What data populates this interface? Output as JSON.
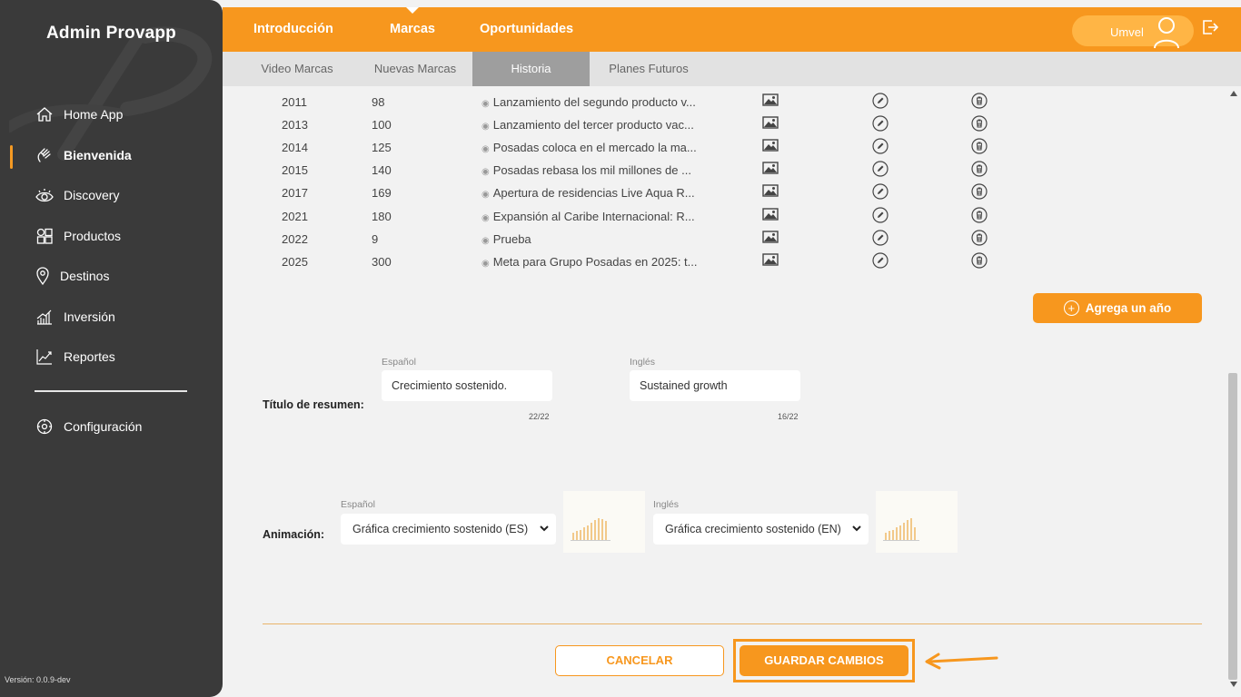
{
  "sidebar": {
    "title": "Admin Provapp",
    "items": [
      {
        "label": "Home App",
        "icon": "home-icon"
      },
      {
        "label": "Bienvenida",
        "icon": "waving-hand-icon",
        "active": true
      },
      {
        "label": "Discovery",
        "icon": "eye-icon"
      },
      {
        "label": "Productos",
        "icon": "grid-icon"
      },
      {
        "label": "Destinos",
        "icon": "map-pin-icon"
      },
      {
        "label": "Inversión",
        "icon": "bar-chart-icon"
      },
      {
        "label": "Reportes",
        "icon": "line-chart-icon"
      }
    ],
    "settings": {
      "label": "Configuración",
      "icon": "gear-icon"
    },
    "version": "Versión: 0.0.9-dev"
  },
  "topbar": {
    "tabs": [
      {
        "label": "Introducción"
      },
      {
        "label": "Marcas",
        "active": true
      },
      {
        "label": "Oportunidades"
      }
    ],
    "user": "Umvel"
  },
  "subtabs": [
    {
      "label": "Video Marcas"
    },
    {
      "label": "Nuevas Marcas"
    },
    {
      "label": "Historia",
      "active": true
    },
    {
      "label": "Planes Futuros"
    }
  ],
  "history_rows": [
    {
      "year": "2011",
      "value": "98",
      "desc": "Lanzamiento del segundo producto v..."
    },
    {
      "year": "2013",
      "value": "100",
      "desc": "Lanzamiento del tercer producto vac..."
    },
    {
      "year": "2014",
      "value": "125",
      "desc": "Posadas coloca en el mercado la ma..."
    },
    {
      "year": "2015",
      "value": "140",
      "desc": "Posadas rebasa los mil millones de ..."
    },
    {
      "year": "2017",
      "value": "169",
      "desc": "Apertura de residencias Live Aqua R..."
    },
    {
      "year": "2021",
      "value": "180",
      "desc": "Expansión al Caribe Internacional: R..."
    },
    {
      "year": "2022",
      "value": "9",
      "desc": "Prueba"
    },
    {
      "year": "2025",
      "value": "300",
      "desc": "Meta para Grupo Posadas en 2025: t..."
    }
  ],
  "add_year_label": "Agrega un año",
  "summary": {
    "label": "Título de resumen:",
    "es_label": "Español",
    "es_value": "Crecimiento sostenido.",
    "es_count": "22/22",
    "en_label": "Inglés",
    "en_value": "Sustained growth",
    "en_count": "16/22"
  },
  "animation": {
    "label": "Animación:",
    "es_label": "Español",
    "es_value": "Gráfica crecimiento sostenido (ES)",
    "en_label": "Inglés",
    "en_value": "Gráfica crecimiento sostenido (EN)"
  },
  "actions": {
    "cancel": "CANCELAR",
    "save": "GUARDAR CAMBIOS"
  },
  "colors": {
    "accent": "#f7971e",
    "sidebar": "#3a3a3a"
  }
}
